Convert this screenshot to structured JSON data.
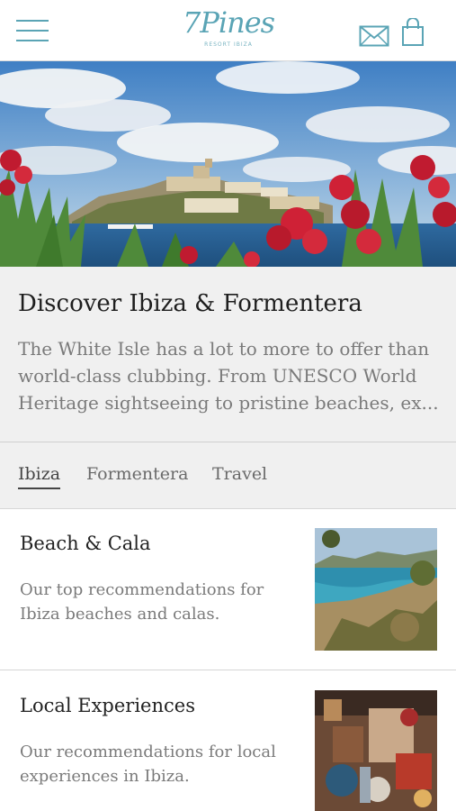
{
  "header": {
    "logo_main": "7Pines",
    "logo_sub": "RESORT IBIZA",
    "icons": [
      "hamburger-menu-icon",
      "mail-icon",
      "shopping-bag-icon"
    ],
    "accent_color": "#5aa4b5"
  },
  "intro": {
    "title": "Discover Ibiza & Formentera",
    "text": "The White Isle has a lot to more to offer than world-class clubbing. From UNESCO World Heritage sightseeing to pristine beaches, ex..."
  },
  "tabs": [
    {
      "label": "Ibiza",
      "active": true
    },
    {
      "label": "Formentera",
      "active": false
    },
    {
      "label": "Travel",
      "active": false
    }
  ],
  "cards": [
    {
      "title": "Beach & Cala",
      "description": "Our top recommendations for Ibiza beaches and calas."
    },
    {
      "title": "Local Experiences",
      "description": "Our recommendations for local experiences in Ibiza."
    }
  ]
}
